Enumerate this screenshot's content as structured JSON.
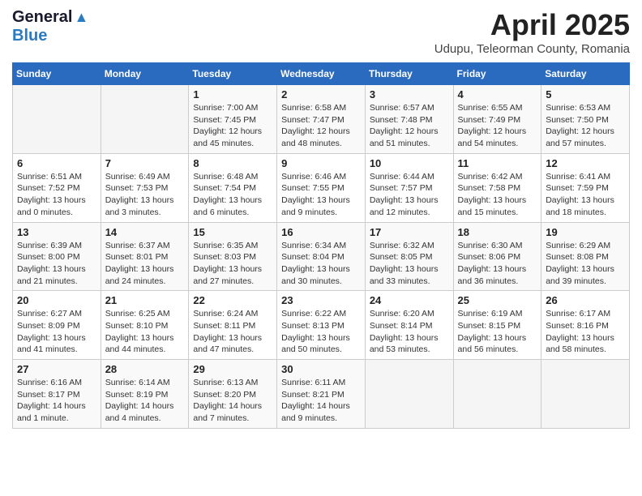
{
  "header": {
    "logo_general": "General",
    "logo_blue": "Blue",
    "month_title": "April 2025",
    "location": "Udupu, Teleorman County, Romania"
  },
  "calendar": {
    "days_of_week": [
      "Sunday",
      "Monday",
      "Tuesday",
      "Wednesday",
      "Thursday",
      "Friday",
      "Saturday"
    ],
    "weeks": [
      [
        {
          "day": "",
          "info": ""
        },
        {
          "day": "",
          "info": ""
        },
        {
          "day": "1",
          "info": "Sunrise: 7:00 AM\nSunset: 7:45 PM\nDaylight: 12 hours\nand 45 minutes."
        },
        {
          "day": "2",
          "info": "Sunrise: 6:58 AM\nSunset: 7:47 PM\nDaylight: 12 hours\nand 48 minutes."
        },
        {
          "day": "3",
          "info": "Sunrise: 6:57 AM\nSunset: 7:48 PM\nDaylight: 12 hours\nand 51 minutes."
        },
        {
          "day": "4",
          "info": "Sunrise: 6:55 AM\nSunset: 7:49 PM\nDaylight: 12 hours\nand 54 minutes."
        },
        {
          "day": "5",
          "info": "Sunrise: 6:53 AM\nSunset: 7:50 PM\nDaylight: 12 hours\nand 57 minutes."
        }
      ],
      [
        {
          "day": "6",
          "info": "Sunrise: 6:51 AM\nSunset: 7:52 PM\nDaylight: 13 hours\nand 0 minutes."
        },
        {
          "day": "7",
          "info": "Sunrise: 6:49 AM\nSunset: 7:53 PM\nDaylight: 13 hours\nand 3 minutes."
        },
        {
          "day": "8",
          "info": "Sunrise: 6:48 AM\nSunset: 7:54 PM\nDaylight: 13 hours\nand 6 minutes."
        },
        {
          "day": "9",
          "info": "Sunrise: 6:46 AM\nSunset: 7:55 PM\nDaylight: 13 hours\nand 9 minutes."
        },
        {
          "day": "10",
          "info": "Sunrise: 6:44 AM\nSunset: 7:57 PM\nDaylight: 13 hours\nand 12 minutes."
        },
        {
          "day": "11",
          "info": "Sunrise: 6:42 AM\nSunset: 7:58 PM\nDaylight: 13 hours\nand 15 minutes."
        },
        {
          "day": "12",
          "info": "Sunrise: 6:41 AM\nSunset: 7:59 PM\nDaylight: 13 hours\nand 18 minutes."
        }
      ],
      [
        {
          "day": "13",
          "info": "Sunrise: 6:39 AM\nSunset: 8:00 PM\nDaylight: 13 hours\nand 21 minutes."
        },
        {
          "day": "14",
          "info": "Sunrise: 6:37 AM\nSunset: 8:01 PM\nDaylight: 13 hours\nand 24 minutes."
        },
        {
          "day": "15",
          "info": "Sunrise: 6:35 AM\nSunset: 8:03 PM\nDaylight: 13 hours\nand 27 minutes."
        },
        {
          "day": "16",
          "info": "Sunrise: 6:34 AM\nSunset: 8:04 PM\nDaylight: 13 hours\nand 30 minutes."
        },
        {
          "day": "17",
          "info": "Sunrise: 6:32 AM\nSunset: 8:05 PM\nDaylight: 13 hours\nand 33 minutes."
        },
        {
          "day": "18",
          "info": "Sunrise: 6:30 AM\nSunset: 8:06 PM\nDaylight: 13 hours\nand 36 minutes."
        },
        {
          "day": "19",
          "info": "Sunrise: 6:29 AM\nSunset: 8:08 PM\nDaylight: 13 hours\nand 39 minutes."
        }
      ],
      [
        {
          "day": "20",
          "info": "Sunrise: 6:27 AM\nSunset: 8:09 PM\nDaylight: 13 hours\nand 41 minutes."
        },
        {
          "day": "21",
          "info": "Sunrise: 6:25 AM\nSunset: 8:10 PM\nDaylight: 13 hours\nand 44 minutes."
        },
        {
          "day": "22",
          "info": "Sunrise: 6:24 AM\nSunset: 8:11 PM\nDaylight: 13 hours\nand 47 minutes."
        },
        {
          "day": "23",
          "info": "Sunrise: 6:22 AM\nSunset: 8:13 PM\nDaylight: 13 hours\nand 50 minutes."
        },
        {
          "day": "24",
          "info": "Sunrise: 6:20 AM\nSunset: 8:14 PM\nDaylight: 13 hours\nand 53 minutes."
        },
        {
          "day": "25",
          "info": "Sunrise: 6:19 AM\nSunset: 8:15 PM\nDaylight: 13 hours\nand 56 minutes."
        },
        {
          "day": "26",
          "info": "Sunrise: 6:17 AM\nSunset: 8:16 PM\nDaylight: 13 hours\nand 58 minutes."
        }
      ],
      [
        {
          "day": "27",
          "info": "Sunrise: 6:16 AM\nSunset: 8:17 PM\nDaylight: 14 hours\nand 1 minute."
        },
        {
          "day": "28",
          "info": "Sunrise: 6:14 AM\nSunset: 8:19 PM\nDaylight: 14 hours\nand 4 minutes."
        },
        {
          "day": "29",
          "info": "Sunrise: 6:13 AM\nSunset: 8:20 PM\nDaylight: 14 hours\nand 7 minutes."
        },
        {
          "day": "30",
          "info": "Sunrise: 6:11 AM\nSunset: 8:21 PM\nDaylight: 14 hours\nand 9 minutes."
        },
        {
          "day": "",
          "info": ""
        },
        {
          "day": "",
          "info": ""
        },
        {
          "day": "",
          "info": ""
        }
      ]
    ]
  }
}
